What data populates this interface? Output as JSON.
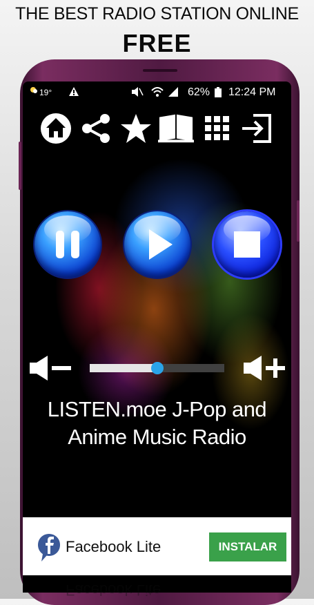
{
  "promo": {
    "headline": "THE BEST RADIO STATION ONLINE",
    "subheadline": "FREE"
  },
  "status_bar": {
    "temperature": "19°",
    "battery": "62%",
    "time": "12:24 PM"
  },
  "toolbar": {
    "icons": [
      "home-icon",
      "share-icon",
      "star-icon",
      "book-icon",
      "grid-icon",
      "exit-icon"
    ]
  },
  "player": {
    "controls": [
      "pause",
      "play",
      "stop"
    ],
    "volume_level": 0.5
  },
  "station": {
    "line1": "LISTEN.moe J-Pop and",
    "line2": "Anime Music Radio"
  },
  "ad": {
    "app_name": "Facebook Lite",
    "install_label": "INSTALAR",
    "reflection_text": "Facebook Lite"
  },
  "colors": {
    "install_button": "#3aa14a",
    "slider_thumb": "#2aa3e8",
    "play_button": "#1a6fe8",
    "phone_frame": "#6b2555"
  }
}
